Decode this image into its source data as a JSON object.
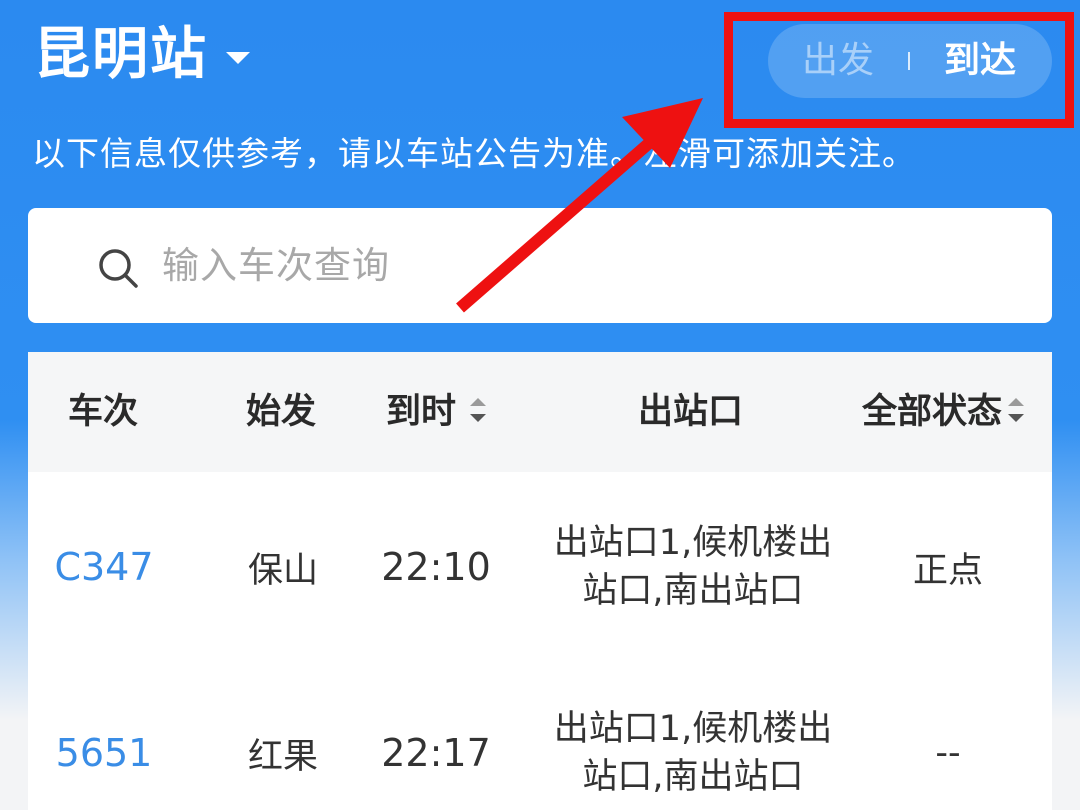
{
  "header": {
    "station": "昆明站",
    "toggle": {
      "depart": "出发",
      "arrive": "到达",
      "active": "arrive"
    },
    "notice": "以下信息仅供参考，请以车站公告为准。左滑可添加关注。"
  },
  "search": {
    "placeholder": "输入车次查询"
  },
  "table": {
    "columns": [
      "车次",
      "始发",
      "到时",
      "出站口",
      "全部状态"
    ],
    "rows": [
      {
        "train": "C347",
        "origin": "保山",
        "time": "22:10",
        "exit": "出站口1,候机楼出站口,南出站口",
        "status": "正点"
      },
      {
        "train": "5651",
        "origin": "红果",
        "time": "22:17",
        "exit": "出站口1,候机楼出站口,南出站口",
        "status": "--"
      }
    ]
  },
  "colors": {
    "primary": "#2b8af0",
    "link": "#3a8de6",
    "annotation": "#ee1111"
  }
}
